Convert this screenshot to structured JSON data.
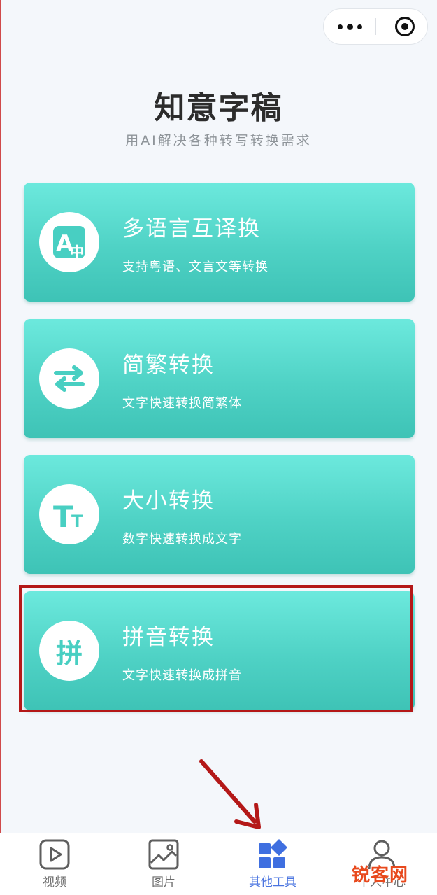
{
  "header": {
    "title": "知意字稿",
    "subtitle": "用AI解决各种转写转换需求",
    "capsule_icons": [
      "more-dots-icon",
      "close-target-icon"
    ]
  },
  "cards": [
    {
      "title": "多语言互译换",
      "desc": "支持粤语、文言文等转换",
      "icon": "translate-icon",
      "icon_text": "A",
      "icon_sub": "中"
    },
    {
      "title": "简繁转换",
      "desc": "文字快速转换简繁体",
      "icon": "swap-arrows-icon"
    },
    {
      "title": "大小转换",
      "desc": "数字快速转换成文字",
      "icon": "text-size-icon",
      "icon_text": "T",
      "icon_sub": "T"
    },
    {
      "title": "拼音转换",
      "desc": "文字快速转换成拼音",
      "icon": "pinyin-icon",
      "icon_text": "拼",
      "highlighted": true
    }
  ],
  "tabs": [
    {
      "label": "视频",
      "icon": "video-icon",
      "active": false
    },
    {
      "label": "图片",
      "icon": "image-icon",
      "active": false
    },
    {
      "label": "其他工具",
      "icon": "tools-grid-icon",
      "active": true
    },
    {
      "label": "个人中心",
      "icon": "user-icon",
      "active": false
    }
  ],
  "watermark": "锐客网",
  "colors": {
    "card_top": "#6ce9dd",
    "card_bottom": "#3ec3b6",
    "active_tab": "#4a74e0",
    "highlight": "#b41818",
    "arrow": "#b41818"
  }
}
